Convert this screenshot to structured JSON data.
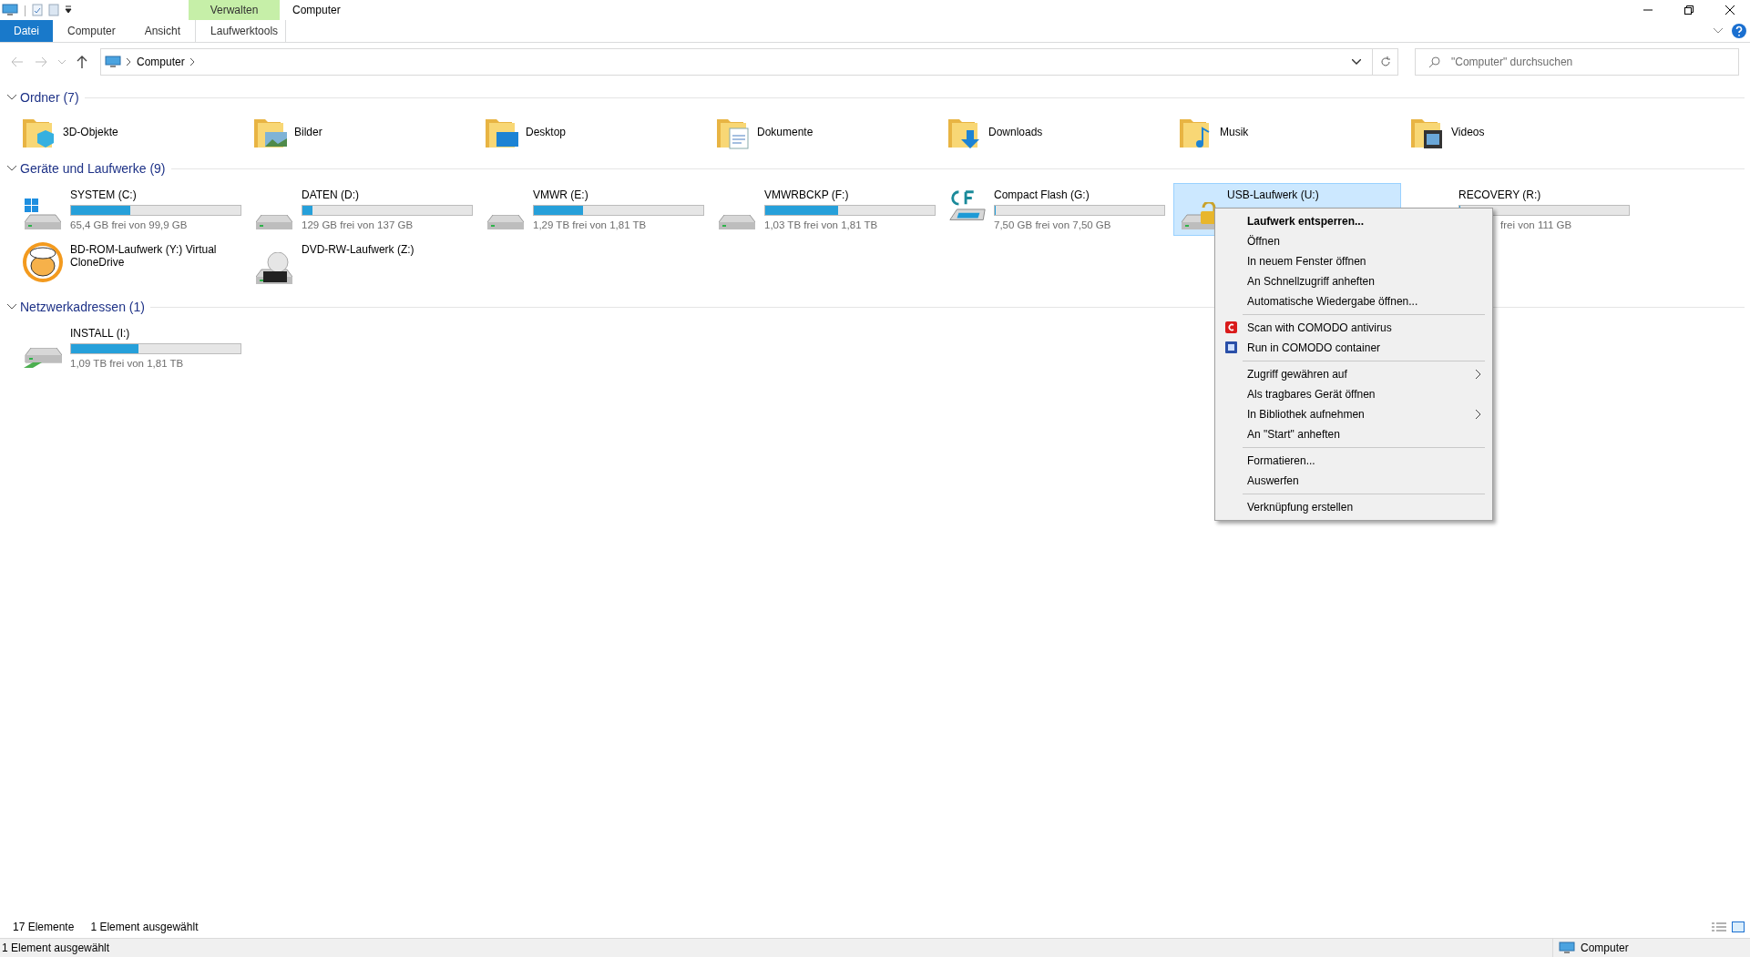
{
  "quick_access_toolbar": {
    "separator": "|"
  },
  "ribbon": {
    "context_group": "Verwalten",
    "window_title": "Computer",
    "tabs": [
      {
        "label": "Datei",
        "kind": "file",
        "selected": false
      },
      {
        "label": "Computer",
        "kind": "tab",
        "selected": false
      },
      {
        "label": "Ansicht",
        "kind": "tab",
        "selected": false
      },
      {
        "label": "Laufwerktools",
        "kind": "context",
        "selected": false
      }
    ]
  },
  "address_bar": {
    "path": [
      "Computer"
    ]
  },
  "search": {
    "placeholder": "\"Computer\" durchsuchen"
  },
  "groups": [
    {
      "title": "Ordner (7)",
      "expanded": true,
      "kind": "folders",
      "items": [
        {
          "name": "3D-Objekte"
        },
        {
          "name": "Bilder"
        },
        {
          "name": "Desktop"
        },
        {
          "name": "Dokumente"
        },
        {
          "name": "Downloads"
        },
        {
          "name": "Musik"
        },
        {
          "name": "Videos"
        }
      ]
    },
    {
      "title": "Geräte und Laufwerke (9)",
      "expanded": true,
      "kind": "drives",
      "items": [
        {
          "name": "SYSTEM (C:)",
          "level": 0.35,
          "free": "65,4 GB frei von 99,9 GB",
          "selected": false
        },
        {
          "name": "DATEN (D:)",
          "level": 0.06,
          "free": "129 GB frei von 137 GB",
          "selected": false
        },
        {
          "name": "VMWR (E:)",
          "level": 0.29,
          "free": "1,29 TB frei von 1,81 TB",
          "selected": false
        },
        {
          "name": "VMWRBCKP (F:)",
          "level": 0.43,
          "free": "1,03 TB frei von 1,81 TB",
          "selected": false
        },
        {
          "name": "Compact Flash (G:)",
          "level": 0,
          "free": "7,50 GB frei von 7,50 GB",
          "selected": false
        },
        {
          "name": "USB-Laufwerk (U:)",
          "selected": true
        },
        {
          "name": "RECOVERY (R:)",
          "level": 0,
          "free": "frei von 111 GB",
          "selected": false,
          "covered": true
        },
        {
          "name": "BD-ROM-Laufwerk (Y:) Virtual CloneDrive",
          "selected": false
        },
        {
          "name": "DVD-RW-Laufwerk (Z:)",
          "selected": false
        }
      ]
    },
    {
      "title": "Netzwerkadressen (1)",
      "expanded": true,
      "kind": "drives",
      "items": [
        {
          "name": "INSTALL (I:)",
          "level": 0.4,
          "free": "1,09 TB frei von 1,81 TB",
          "selected": false
        }
      ]
    }
  ],
  "context_menu": {
    "items": [
      {
        "kind": "item",
        "label": "Laufwerk entsperren...",
        "default": true
      },
      {
        "kind": "item",
        "label": "Öffnen"
      },
      {
        "kind": "item",
        "label": "In neuem Fenster öffnen"
      },
      {
        "kind": "item",
        "label": "An Schnellzugriff anheften"
      },
      {
        "kind": "item",
        "label": "Automatische Wiedergabe öffnen..."
      },
      {
        "kind": "separator"
      },
      {
        "kind": "item",
        "label": "Scan with COMODO antivirus"
      },
      {
        "kind": "item",
        "label": "Run in COMODO container"
      },
      {
        "kind": "separator"
      },
      {
        "kind": "item",
        "label": "Zugriff gewähren auf",
        "submenu": true
      },
      {
        "kind": "item",
        "label": "Als tragbares Gerät öffnen"
      },
      {
        "kind": "item",
        "label": "In Bibliothek aufnehmen",
        "submenu": true
      },
      {
        "kind": "item",
        "label": "An \"Start\" anheften"
      },
      {
        "kind": "separator"
      },
      {
        "kind": "item",
        "label": "Formatieren..."
      },
      {
        "kind": "item",
        "label": "Auswerfen"
      },
      {
        "kind": "separator"
      },
      {
        "kind": "item",
        "label": "Verknüpfung erstellen"
      }
    ]
  },
  "status": {
    "count": "17 Elemente",
    "selection": "1 Element ausgewählt"
  },
  "status_bar": {
    "left": "1 Element ausgewählt",
    "right": "Computer"
  }
}
